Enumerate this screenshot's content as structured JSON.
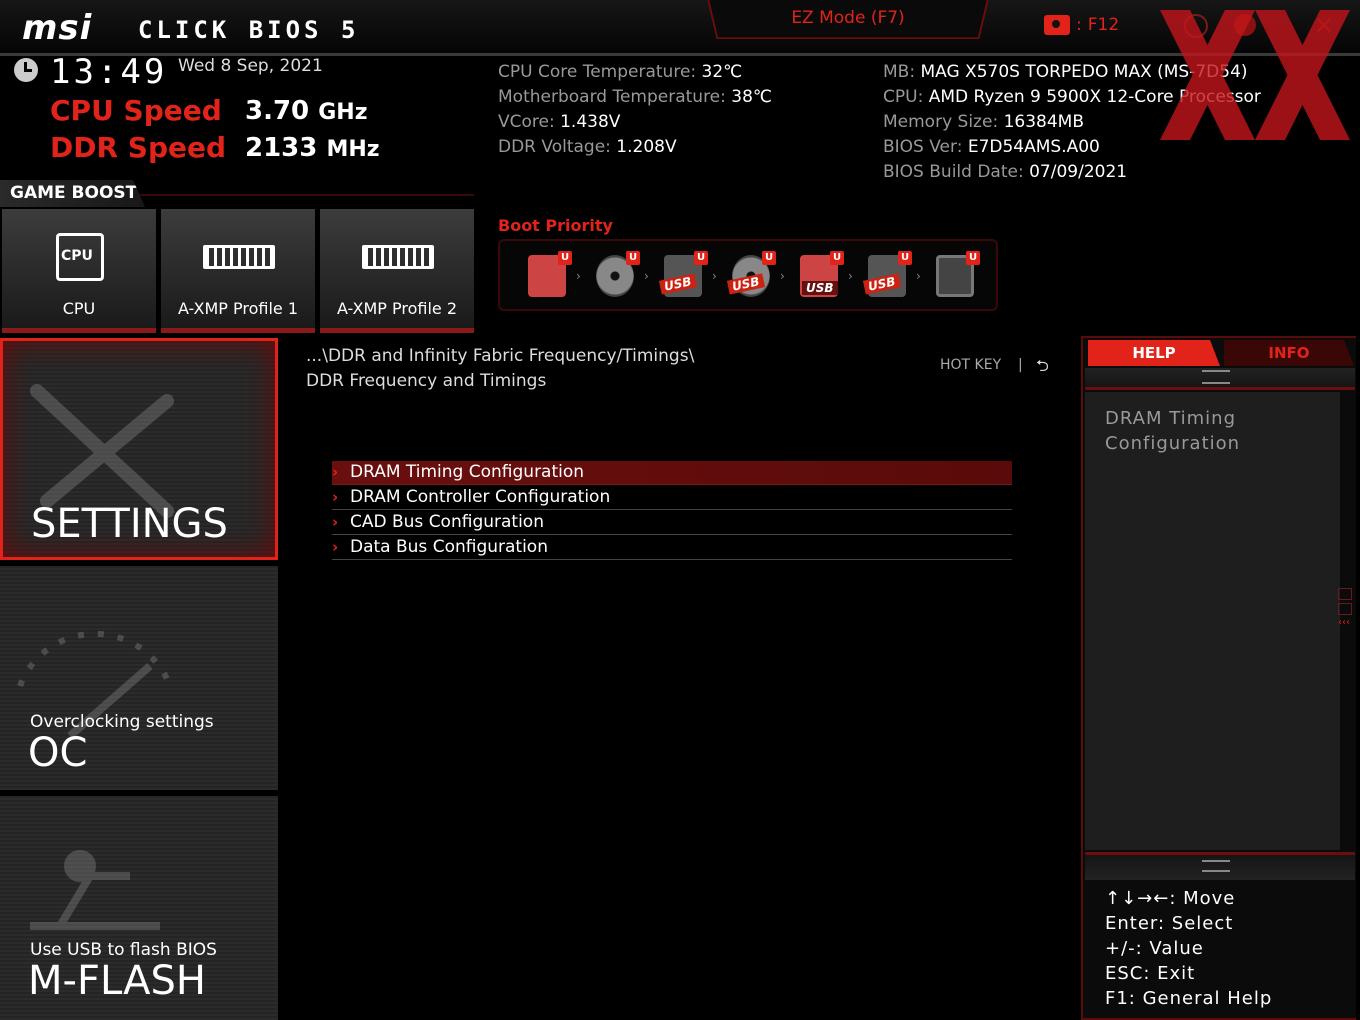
{
  "header": {
    "brand": "msi",
    "bios_name": "CLICK BIOS 5",
    "ez_mode": "EZ Mode (F7)",
    "screenshot_key": "F12",
    "time": "13:49",
    "date": "Wed  8 Sep, 2021",
    "cpu_speed_label": "CPU Speed",
    "cpu_speed_value": "3.70",
    "cpu_speed_unit": "GHz",
    "ddr_speed_label": "DDR Speed",
    "ddr_speed_value": "2133",
    "ddr_speed_unit": "MHz"
  },
  "system_info": {
    "cpu_temp_label": "CPU Core Temperature: ",
    "cpu_temp": "32℃",
    "mb_temp_label": "Motherboard Temperature: ",
    "mb_temp": "38℃",
    "vcore_label": "VCore: ",
    "vcore": "1.438V",
    "ddr_voltage_label": "DDR Voltage: ",
    "ddr_voltage": "1.208V",
    "mb_label": "MB: ",
    "mb": "MAG X570S TORPEDO MAX (MS-7D54)",
    "cpu_label": "CPU: ",
    "cpu": "AMD Ryzen 9 5900X 12-Core Processor",
    "mem_label": "Memory Size: ",
    "mem": "16384MB",
    "bios_ver_label": "BIOS Ver: ",
    "bios_ver": "E7D54AMS.A00",
    "bios_date_label": "BIOS Build Date: ",
    "bios_date": "07/09/2021"
  },
  "game_boost": {
    "label": "GAME BOOST",
    "tiles": [
      {
        "label": "CPU",
        "icon": "cpu-icon"
      },
      {
        "label": "A-XMP Profile 1",
        "icon": "memory-icon"
      },
      {
        "label": "A-XMP Profile 2",
        "icon": "memory-icon"
      }
    ]
  },
  "boot": {
    "title": "Boot Priority",
    "usb_tag": "USB",
    "usb_badge": "U"
  },
  "sidebar": {
    "settings": {
      "label": "SETTINGS"
    },
    "oc": {
      "sub": "Overclocking settings",
      "label": "OC"
    },
    "mflash": {
      "sub": "Use USB to flash BIOS",
      "label": "M-FLASH"
    }
  },
  "main": {
    "breadcrumb_path": "...\\DDR and Infinity Fabric Frequency/Timings\\",
    "breadcrumb_page": "DDR Frequency and Timings",
    "hotkey_label": "HOT KEY",
    "hotkey_sep": "|",
    "menu": [
      "DRAM Timing Configuration",
      "DRAM Controller Configuration",
      "CAD Bus Configuration",
      "Data Bus Configuration"
    ]
  },
  "help": {
    "tab_help": "HELP",
    "tab_info": "INFO",
    "text": "DRAM Timing Configuration",
    "keys": [
      "↑↓→←: Move",
      "Enter: Select",
      "+/-: Value",
      "ESC: Exit",
      "F1: General Help"
    ]
  },
  "colors": {
    "accent": "#e2231a",
    "dark_red": "#5a0a0a",
    "background": "#000000"
  }
}
